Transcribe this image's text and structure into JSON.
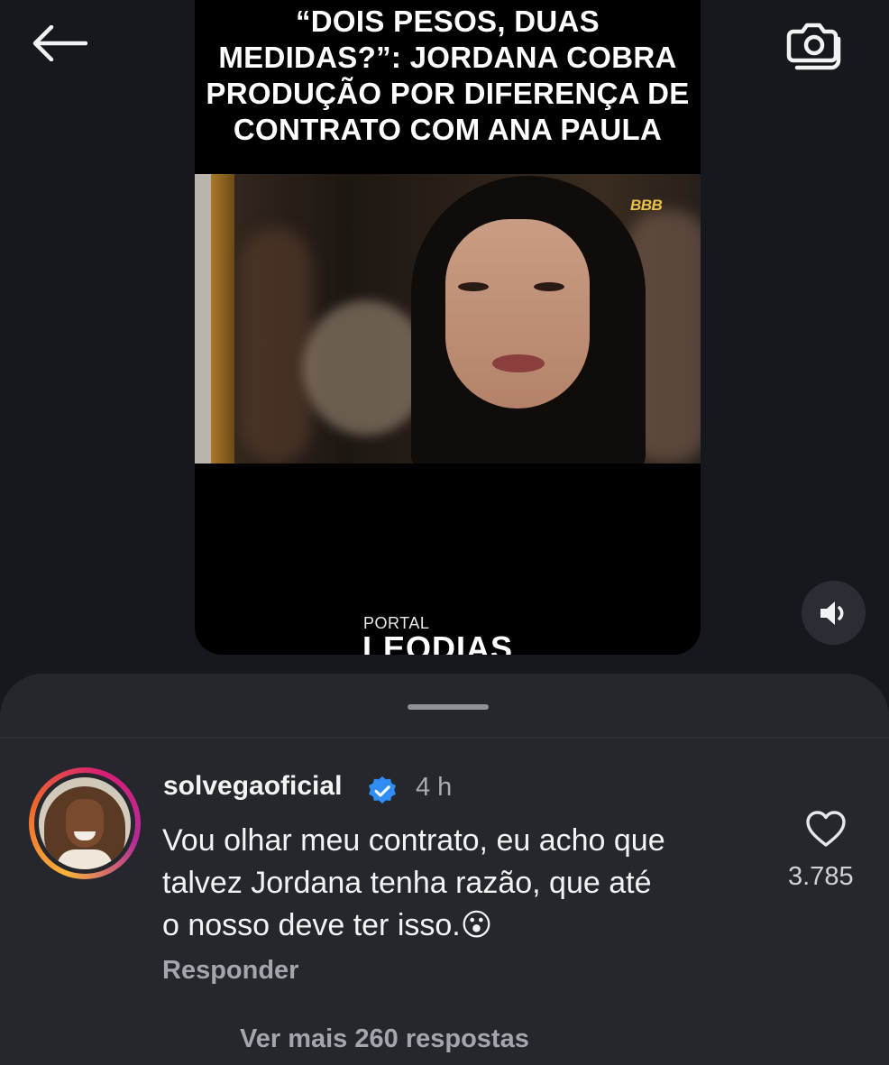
{
  "toolbar": {
    "back_icon": "arrow-left-icon",
    "camera_icon": "camera-flip-icon"
  },
  "video": {
    "headline": "“DOIS PESOS, DUAS\nMEDIDAS?”: JORDANA COBRA\nPRODUÇÃO POR DIFERENÇA DE\nCONTRATO COM ANA PAULA",
    "watermark": "BBB",
    "brand_small": "PORTAL",
    "brand_big": "LEODIAS",
    "volume_icon": "speaker-volume-icon"
  },
  "comments": {
    "comment": {
      "username": "solvegaoficial",
      "verified": true,
      "time": "4 h",
      "text": "Vou olhar meu contrato, eu acho que\ntalvez Jordana tenha razão, que até\no nosso deve ter isso.😮",
      "reply_label": "Responder",
      "likes": "3.785",
      "like_icon": "heart-outline-icon"
    },
    "more_replies_label": "Ver mais 260 respostas"
  },
  "colors": {
    "background": "#15181d",
    "sheet": "#25272c",
    "verified_badge": "#2f8df5",
    "story_ring": [
      "#f8b23a",
      "#d81e74",
      "#b32b9a"
    ]
  }
}
